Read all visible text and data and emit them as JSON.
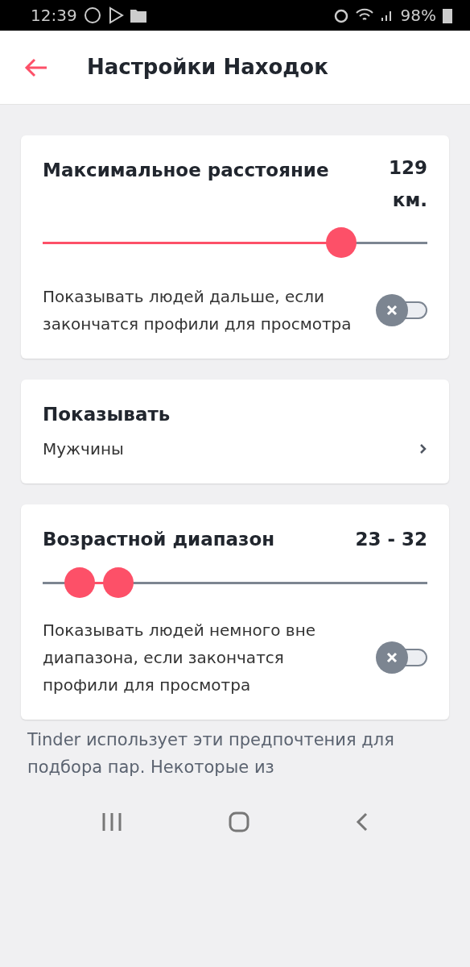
{
  "status_bar": {
    "time": "12:39",
    "battery": "98%"
  },
  "header": {
    "title": "Настройки Находок"
  },
  "distance": {
    "title": "Максимальное расстояние",
    "value": "129 км.",
    "level": 0.776,
    "toggle_label": "Показывать людей дальше, если закончатся профили для просмотра",
    "toggle_on": false
  },
  "show": {
    "title": "Показывать",
    "value": "Мужчины"
  },
  "age": {
    "title": "Возрастной диапазон",
    "value": "23 - 32",
    "thumbs": [
      {
        "level": 0.096
      },
      {
        "level": 0.197
      }
    ],
    "toggle_label": "Показывать людей немного вне диапазона, если закончатся профили для просмотра",
    "toggle_on": false
  },
  "footer_text": "Tinder использует эти предпочтения для подбора пар. Некоторые из"
}
